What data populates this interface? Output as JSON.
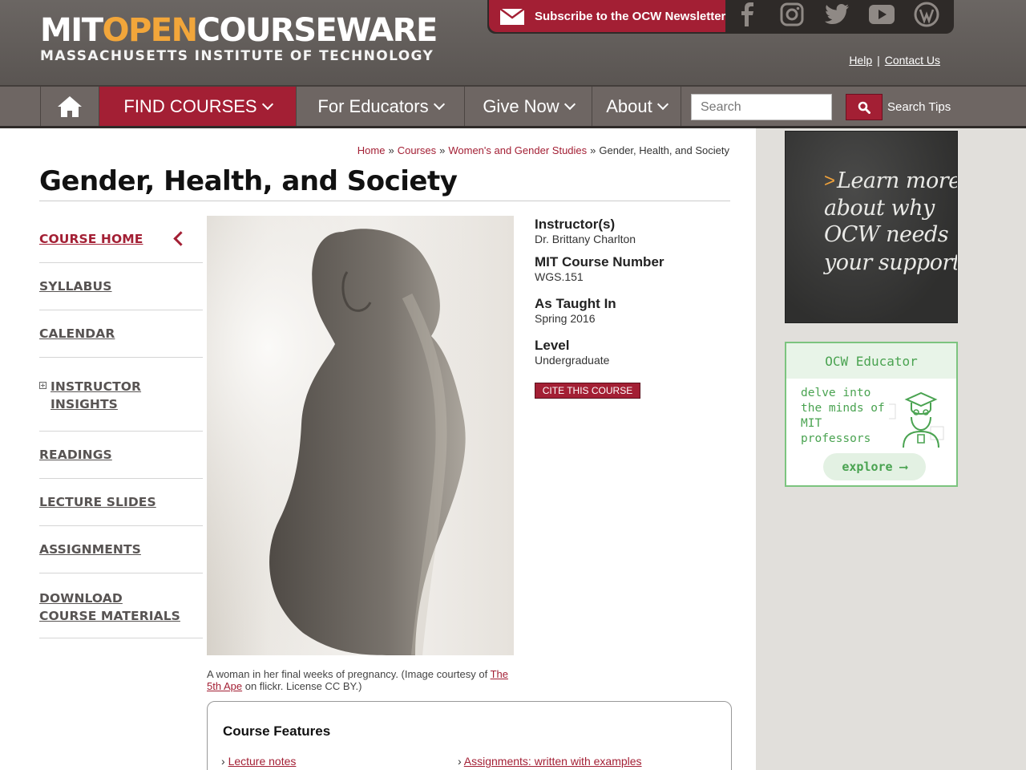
{
  "header": {
    "logo_part1": "MIT",
    "logo_part2": "OPEN",
    "logo_part3": "COURSEWARE",
    "logo_sub": "MASSACHUSETTS INSTITUTE OF TECHNOLOGY",
    "subscribe_label": "Subscribe to the OCW Newsletter",
    "social_icons": [
      "facebook-icon",
      "instagram-icon",
      "twitter-icon",
      "youtube-icon",
      "wordpress-icon"
    ],
    "help_label": "Help",
    "separator": "|",
    "contact_label": "Contact Us"
  },
  "nav": {
    "items": [
      "FIND COURSES",
      "For Educators",
      "Give Now",
      "About"
    ],
    "search_placeholder": "Search",
    "search_tips": "Search Tips"
  },
  "breadcrumb": {
    "items": [
      "Home",
      "Courses",
      "Women's and Gender Studies"
    ],
    "current": "Gender, Health, and Society",
    "separator": "»"
  },
  "page_title": "Gender, Health, and Society",
  "left_nav": [
    "COURSE HOME",
    "SYLLABUS",
    "CALENDAR",
    "INSTRUCTOR INSIGHTS",
    "READINGS",
    "LECTURE SLIDES",
    "ASSIGNMENTS",
    "DOWNLOAD COURSE MATERIALS"
  ],
  "course_info": {
    "instructor_label": "Instructor(s)",
    "instructor_value": "Dr. Brittany Charlton",
    "number_label": "MIT Course Number",
    "number_value": "WGS.151",
    "taught_label": "As Taught In",
    "taught_value": "Spring 2016",
    "level_label": "Level",
    "level_value": "Undergraduate",
    "cite_label": "CITE THIS COURSE"
  },
  "caption": {
    "text1": "A woman in her final weeks of pregnancy. (Image courtesy of ",
    "link1": "The 5th Ape",
    "text2": " on flickr. License CC BY.)"
  },
  "features": {
    "title": "Course Features",
    "items": [
      "Lecture notes",
      "Assignments: written with examples"
    ]
  },
  "sidebar": {
    "chalk_arrow": ">",
    "chalk_lines": [
      "Learn more",
      "about why",
      "OCW needs",
      "your support"
    ],
    "educator_title": "OCW Educator",
    "educator_body": "delve into the minds of MIT professors",
    "explore_label": "explore ⟶"
  },
  "colors": {
    "brand_red": "#a31f34",
    "header_gray": "#5f5a57",
    "logo_orange": "#f2a63a",
    "educator_green": "#4aa351"
  }
}
